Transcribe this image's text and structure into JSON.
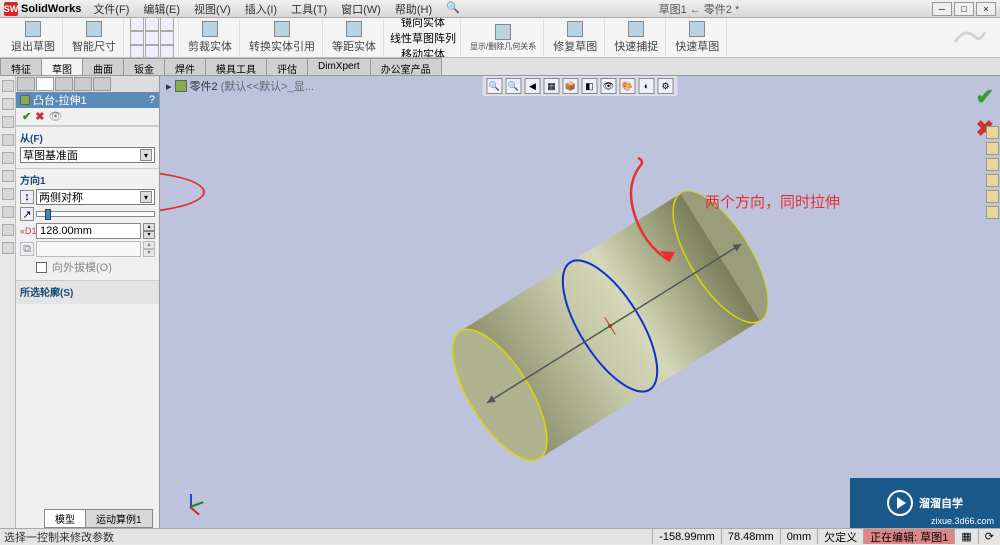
{
  "app": {
    "name": "SolidWorks",
    "doc_title": "草图1 ← 零件2 *"
  },
  "menu": [
    "文件(F)",
    "编辑(E)",
    "视图(V)",
    "插入(I)",
    "工具(T)",
    "窗口(W)",
    "帮助(H)"
  ],
  "ribbon": {
    "exit_sketch": "退出草图",
    "smart_dim": "智能尺寸",
    "trim": "剪裁实体",
    "convert": "转换实体引用",
    "offset": "等距实体",
    "mirror": "镜向实体",
    "linear": "线性草图阵列",
    "move": "移动实体",
    "show": "显示/删除几何关系",
    "repair": "修复草图",
    "quick": "快速捕捉",
    "rapid": "快速草图"
  },
  "cmd_tabs": [
    "特征",
    "草图",
    "曲面",
    "钣金",
    "焊件",
    "模具工具",
    "评估",
    "DimXpert",
    "办公室产品"
  ],
  "active_cmd_tab": 1,
  "feature": {
    "name": "凸台-拉伸1",
    "from_label": "从(F)",
    "from_value": "草图基准面",
    "dir_label": "方向1",
    "dir_value": "两侧对称",
    "depth": "128.00mm",
    "draft_out": "向外拔模(O)",
    "contour_label": "所选轮廓(S)"
  },
  "breadcrumb": {
    "part": "零件2",
    "config": "(默认<<默认>_显..."
  },
  "annotation": "两个方向，同时拉伸",
  "bottom_tabs": [
    "模型",
    "运动算例1"
  ],
  "status": {
    "hint": "选择一控制来修改参数",
    "coord": "-158.99mm",
    "coord2": "78.48mm",
    "dim": "0mm",
    "def": "欠定义",
    "editing": "正在编辑: 草图1"
  },
  "watermark": {
    "brand": "溜溜自学",
    "url": "zixue.3d66.com"
  },
  "chart_data": null
}
